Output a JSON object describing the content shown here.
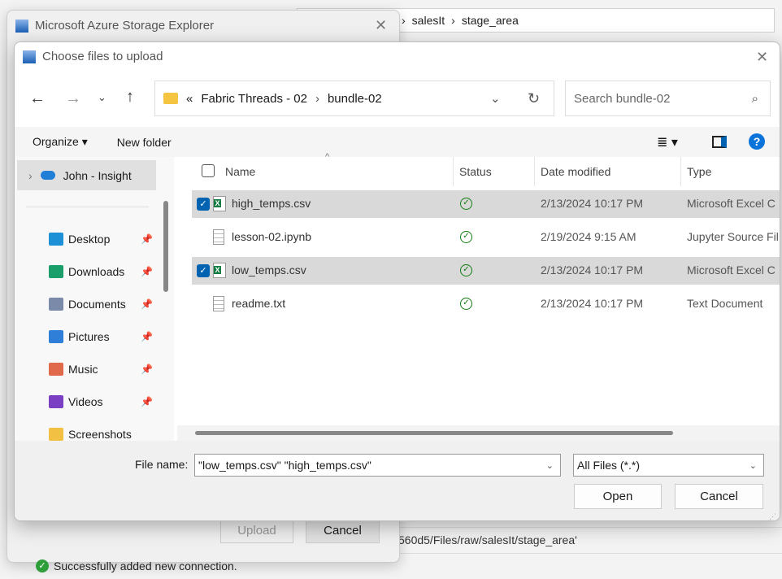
{
  "background": {
    "breadcrumb": [
      "salesIt",
      "stage_area"
    ],
    "path_text": "560d5/Files/raw/salesIt/stage_area'",
    "status_message": "Successfully added new connection."
  },
  "outer_dialog": {
    "title": "Microsoft Azure Storage Explorer",
    "upload_label": "Upload",
    "cancel_label": "Cancel"
  },
  "file_dialog": {
    "title": "Choose files to upload",
    "address": {
      "overflow": "«",
      "segments": [
        "Fabric Threads - 02",
        "bundle-02"
      ]
    },
    "search_placeholder": "Search bundle-02",
    "toolbar": {
      "organize": "Organize",
      "new_folder": "New folder"
    },
    "sidebar": {
      "account": "John - Insight",
      "items": [
        {
          "label": "Desktop",
          "color": "#1e90d6"
        },
        {
          "label": "Downloads",
          "color": "#1a9e6a"
        },
        {
          "label": "Documents",
          "color": "#7a8aa8"
        },
        {
          "label": "Pictures",
          "color": "#2f7fd8"
        },
        {
          "label": "Music",
          "color": "#e0684b"
        },
        {
          "label": "Videos",
          "color": "#7b3fc4"
        },
        {
          "label": "Screenshots",
          "color": "#f2c042"
        }
      ]
    },
    "columns": [
      "Name",
      "Status",
      "Date modified",
      "Type"
    ],
    "files": [
      {
        "name": "high_temps.csv",
        "date": "2/13/2024 10:17 PM",
        "type": "Microsoft Excel C",
        "selected": true,
        "icon": "excel"
      },
      {
        "name": "lesson-02.ipynb",
        "date": "2/19/2024 9:15 AM",
        "type": "Jupyter Source Fil",
        "selected": false,
        "icon": "doc"
      },
      {
        "name": "low_temps.csv",
        "date": "2/13/2024 10:17 PM",
        "type": "Microsoft Excel C",
        "selected": true,
        "icon": "excel"
      },
      {
        "name": "readme.txt",
        "date": "2/13/2024 10:17 PM",
        "type": "Text Document",
        "selected": false,
        "icon": "doc"
      }
    ],
    "file_name_label": "File name:",
    "file_name_value": "\"low_temps.csv\" \"high_temps.csv\"",
    "file_type": "All Files (*.*)",
    "open_label": "Open",
    "cancel_label": "Cancel"
  }
}
